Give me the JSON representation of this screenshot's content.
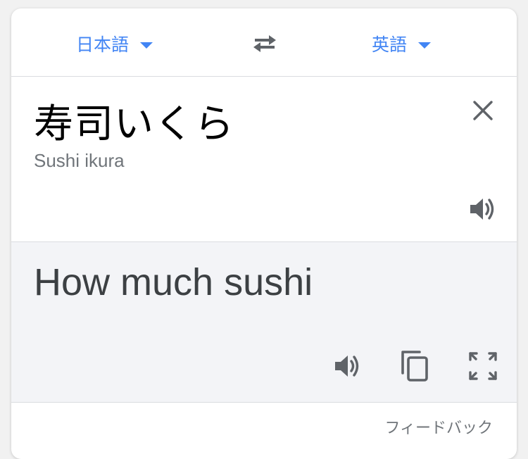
{
  "header": {
    "source_language": "日本語",
    "target_language": "英語",
    "swap_icon": "swap-arrows-icon",
    "dropdown_icon": "caret-down-icon"
  },
  "source": {
    "text": "寿司いくら",
    "romanization": "Sushi ikura",
    "clear_icon": "close-icon",
    "speak_icon": "speaker-icon"
  },
  "result": {
    "text": "How much sushi",
    "speak_icon": "speaker-icon",
    "copy_icon": "copy-icon",
    "fullscreen_icon": "fullscreen-icon"
  },
  "footer": {
    "feedback_label": "フィードバック"
  },
  "colors": {
    "accent": "#4285f4",
    "icon_gray": "#70757a",
    "result_background": "#f3f4f7"
  }
}
